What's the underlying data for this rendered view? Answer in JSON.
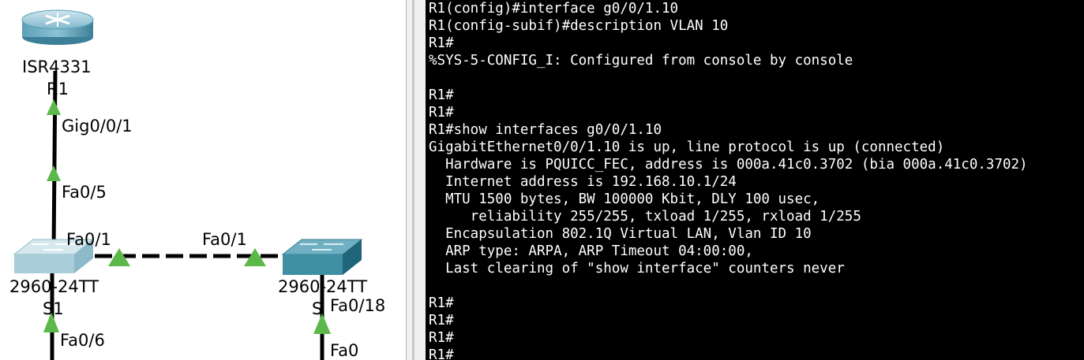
{
  "topology": {
    "router": {
      "model": "ISR4331",
      "name": "R1"
    },
    "switch1": {
      "model": "2960-24TT",
      "name": "S1"
    },
    "switch2": {
      "model": "2960-24TT",
      "name": "S"
    },
    "ports": {
      "r1_down": "Gig0/0/1",
      "s1_up": "Fa0/5",
      "s1_trunk": "Fa0/1",
      "s2_trunk": "Fa0/1",
      "s1_down": "Fa0/6",
      "s2_down": "Fa0/18",
      "s2_pc": "Fa0"
    },
    "colors": {
      "link_up_arrow": "#5cb84a",
      "switch1": "#a9cdd9",
      "switch2": "#3f8fa3",
      "router": "#5aa7c4"
    }
  },
  "terminal": {
    "lines": [
      "R1(config)#interface g0/0/1.10",
      "R1(config-subif)#description VLAN 10",
      "R1#",
      "%SYS-5-CONFIG_I: Configured from console by console",
      "",
      "R1#",
      "R1#",
      "R1#show interfaces g0/0/1.10",
      "GigabitEthernet0/0/1.10 is up, line protocol is up (connected)",
      "  Hardware is PQUICC_FEC, address is 000a.41c0.3702 (bia 000a.41c0.3702)",
      "  Internet address is 192.168.10.1/24",
      "  MTU 1500 bytes, BW 100000 Kbit, DLY 100 usec,",
      "     reliability 255/255, txload 1/255, rxload 1/255",
      "  Encapsulation 802.1Q Virtual LAN, Vlan ID 10",
      "  ARP type: ARPA, ARP Timeout 04:00:00,",
      "  Last clearing of \"show interface\" counters never",
      "",
      "R1#",
      "R1#",
      "R1#",
      "R1#"
    ],
    "colors": {
      "background": "#000000",
      "text": "#ffffff"
    }
  }
}
